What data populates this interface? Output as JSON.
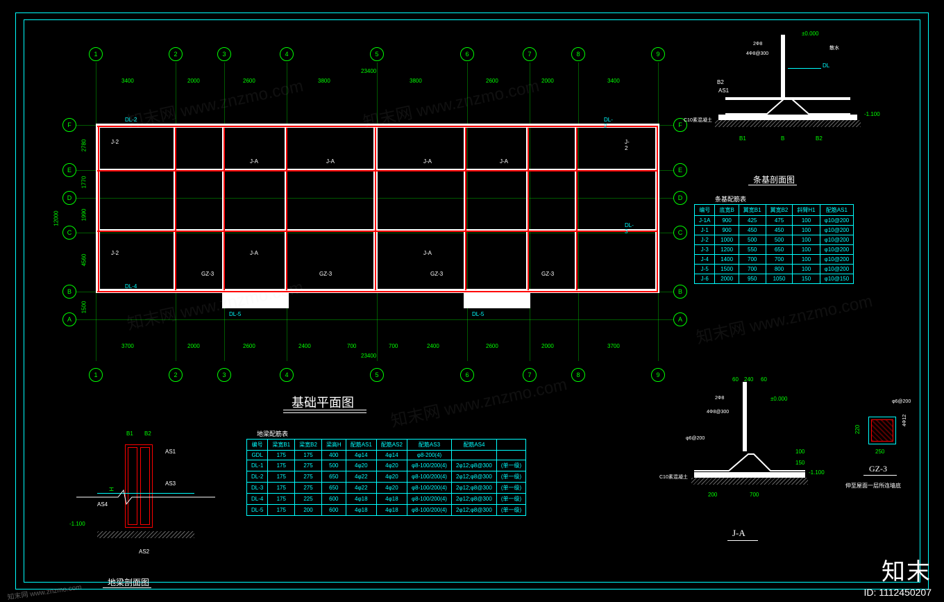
{
  "frame": {
    "dims": "1360x867"
  },
  "plan": {
    "title": "基础平面图",
    "overall_x_dim": "23400",
    "overall_y_dim": "12000",
    "x_dims": [
      "3400",
      "2000",
      "2600",
      "3800",
      "3800",
      "2600",
      "2000",
      "3400"
    ],
    "x_dims_bottom": [
      "3700",
      "2000",
      "2600",
      "2400",
      "700",
      "700",
      "2400",
      "2600",
      "2000",
      "3700"
    ],
    "y_dims_left": [
      "2780",
      "1770",
      "1990",
      "4560",
      "1500"
    ],
    "y_dims_right_inner": "12000",
    "grid_cols": [
      "1",
      "2",
      "3",
      "4",
      "5",
      "6",
      "7",
      "8",
      "9"
    ],
    "grid_rows": [
      "A",
      "B",
      "C",
      "D",
      "E",
      "F"
    ],
    "members": [
      "DL-1",
      "DL-2",
      "DL-3",
      "DL-4",
      "DL-5",
      "GDL"
    ],
    "markers": [
      "J-1",
      "J-1A",
      "J-2",
      "J-3",
      "J-4",
      "J-5",
      "J-6",
      "J-A",
      "GZ-3"
    ]
  },
  "section_strip": {
    "title": "条基剖面图",
    "labels": [
      "DL",
      "AS1",
      "B1",
      "B",
      "B2",
      "2Φ8",
      "4Φ8@300",
      "φ6@200",
      "C10素混凝土",
      "散水"
    ],
    "elev_top": "±0.000",
    "elev_bot": "-1.100"
  },
  "section_beam": {
    "title": "地梁剖面图",
    "labels": [
      "B1",
      "B2",
      "AS1",
      "AS2",
      "AS3",
      "AS4",
      "H"
    ],
    "elev": "-1.100"
  },
  "section_ja": {
    "title": "J-A",
    "labels": [
      "2Φ8",
      "4Φ8@300",
      "φ6@200",
      "C10素混凝土",
      "240",
      "60",
      "60",
      "100",
      "150",
      "200",
      "700"
    ],
    "elev_top": "±0.000",
    "elev_bot": "-1.100"
  },
  "gz3": {
    "title": "GZ-3",
    "note": "伸至屋面一层所连墙底",
    "labels": [
      "φ6@200",
      "4Φ12",
      "250",
      "220"
    ]
  },
  "table_strip": {
    "title": "条基配筋表",
    "headers": [
      "编号",
      "底宽B",
      "翼宽B1",
      "翼宽B2",
      "斜臂H1",
      "配筋AS1"
    ],
    "rows": [
      [
        "J-1A",
        "900",
        "425",
        "475",
        "100",
        "φ10@200"
      ],
      [
        "J-1",
        "900",
        "450",
        "450",
        "100",
        "φ10@200"
      ],
      [
        "J-2",
        "1000",
        "500",
        "500",
        "100",
        "φ10@200"
      ],
      [
        "J-3",
        "1200",
        "550",
        "650",
        "100",
        "φ10@200"
      ],
      [
        "J-4",
        "1400",
        "700",
        "700",
        "100",
        "φ10@200"
      ],
      [
        "J-5",
        "1500",
        "700",
        "800",
        "100",
        "φ10@200"
      ],
      [
        "J-6",
        "2000",
        "950",
        "1050",
        "150",
        "φ10@150"
      ]
    ]
  },
  "table_beam": {
    "title": "地梁配筋表",
    "headers": [
      "编号",
      "梁宽B1",
      "梁宽B2",
      "梁高H",
      "配筋AS1",
      "配筋AS2",
      "配筋AS3",
      "配筋AS4",
      ""
    ],
    "rows": [
      [
        "GDL",
        "175",
        "175",
        "400",
        "4φ14",
        "4φ14",
        "φ8-200(4)",
        "",
        ""
      ],
      [
        "DL-1",
        "175",
        "275",
        "500",
        "4φ20",
        "4φ20",
        "φ8-100/200(4)",
        "2φ12;φ8@300",
        "(单一级)"
      ],
      [
        "DL-2",
        "175",
        "275",
        "650",
        "4φ22",
        "4φ20",
        "φ8-100/200(4)",
        "2φ12;φ8@300",
        "(单一级)"
      ],
      [
        "DL-3",
        "175",
        "275",
        "650",
        "4φ22",
        "4φ20",
        "φ8-100/200(4)",
        "2φ12;φ8@300",
        "(单一级)"
      ],
      [
        "DL-4",
        "175",
        "225",
        "600",
        "4φ18",
        "4φ18",
        "φ8-100/200(4)",
        "2φ12;φ8@300",
        "(单一级)"
      ],
      [
        "DL-5",
        "175",
        "200",
        "600",
        "4φ18",
        "4φ18",
        "φ8-100/200(4)",
        "2φ12;φ8@300",
        "(单一级)"
      ]
    ]
  },
  "watermarks": [
    "知末网 www.znzmo.com",
    "znzmo.com"
  ],
  "brand": {
    "name": "知末",
    "id": "ID: 1112450207"
  }
}
